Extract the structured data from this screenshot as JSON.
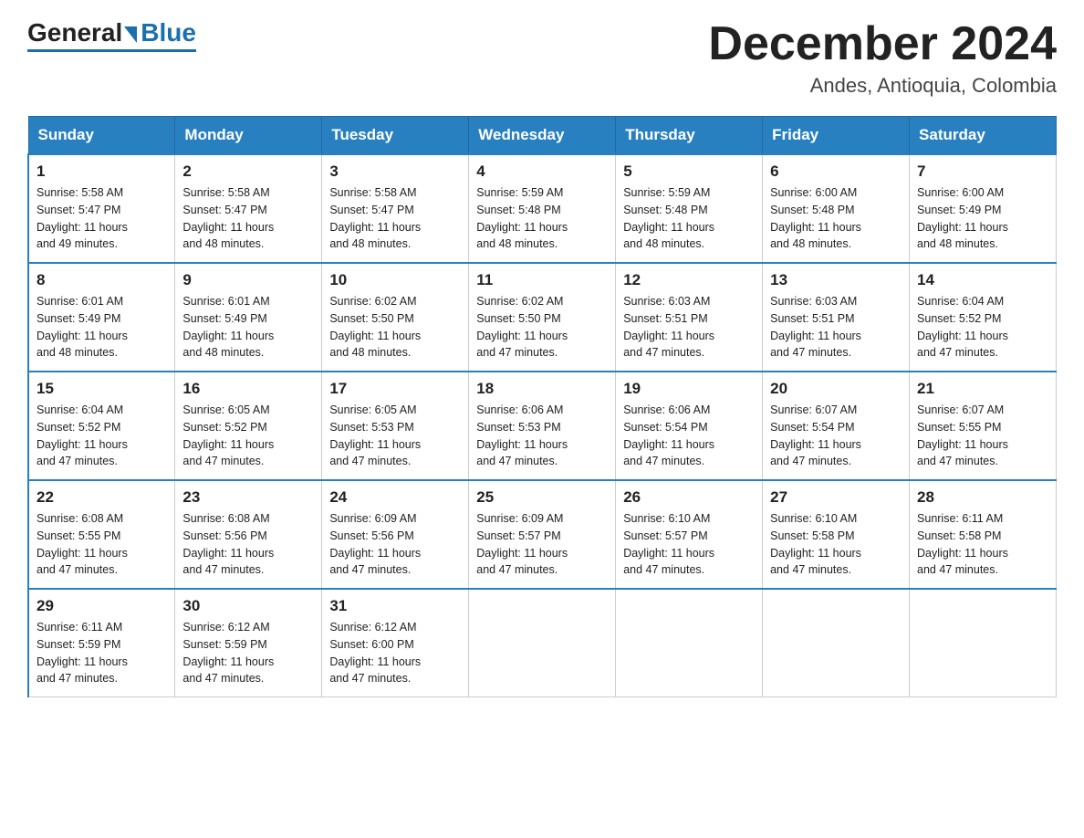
{
  "header": {
    "logo_general": "General",
    "logo_blue": "Blue",
    "month_title": "December 2024",
    "location": "Andes, Antioquia, Colombia"
  },
  "days_of_week": [
    "Sunday",
    "Monday",
    "Tuesday",
    "Wednesday",
    "Thursday",
    "Friday",
    "Saturday"
  ],
  "weeks": [
    [
      {
        "day": "1",
        "sunrise": "5:58 AM",
        "sunset": "5:47 PM",
        "daylight": "11 hours and 49 minutes."
      },
      {
        "day": "2",
        "sunrise": "5:58 AM",
        "sunset": "5:47 PM",
        "daylight": "11 hours and 48 minutes."
      },
      {
        "day": "3",
        "sunrise": "5:58 AM",
        "sunset": "5:47 PM",
        "daylight": "11 hours and 48 minutes."
      },
      {
        "day": "4",
        "sunrise": "5:59 AM",
        "sunset": "5:48 PM",
        "daylight": "11 hours and 48 minutes."
      },
      {
        "day": "5",
        "sunrise": "5:59 AM",
        "sunset": "5:48 PM",
        "daylight": "11 hours and 48 minutes."
      },
      {
        "day": "6",
        "sunrise": "6:00 AM",
        "sunset": "5:48 PM",
        "daylight": "11 hours and 48 minutes."
      },
      {
        "day": "7",
        "sunrise": "6:00 AM",
        "sunset": "5:49 PM",
        "daylight": "11 hours and 48 minutes."
      }
    ],
    [
      {
        "day": "8",
        "sunrise": "6:01 AM",
        "sunset": "5:49 PM",
        "daylight": "11 hours and 48 minutes."
      },
      {
        "day": "9",
        "sunrise": "6:01 AM",
        "sunset": "5:49 PM",
        "daylight": "11 hours and 48 minutes."
      },
      {
        "day": "10",
        "sunrise": "6:02 AM",
        "sunset": "5:50 PM",
        "daylight": "11 hours and 48 minutes."
      },
      {
        "day": "11",
        "sunrise": "6:02 AM",
        "sunset": "5:50 PM",
        "daylight": "11 hours and 47 minutes."
      },
      {
        "day": "12",
        "sunrise": "6:03 AM",
        "sunset": "5:51 PM",
        "daylight": "11 hours and 47 minutes."
      },
      {
        "day": "13",
        "sunrise": "6:03 AM",
        "sunset": "5:51 PM",
        "daylight": "11 hours and 47 minutes."
      },
      {
        "day": "14",
        "sunrise": "6:04 AM",
        "sunset": "5:52 PM",
        "daylight": "11 hours and 47 minutes."
      }
    ],
    [
      {
        "day": "15",
        "sunrise": "6:04 AM",
        "sunset": "5:52 PM",
        "daylight": "11 hours and 47 minutes."
      },
      {
        "day": "16",
        "sunrise": "6:05 AM",
        "sunset": "5:52 PM",
        "daylight": "11 hours and 47 minutes."
      },
      {
        "day": "17",
        "sunrise": "6:05 AM",
        "sunset": "5:53 PM",
        "daylight": "11 hours and 47 minutes."
      },
      {
        "day": "18",
        "sunrise": "6:06 AM",
        "sunset": "5:53 PM",
        "daylight": "11 hours and 47 minutes."
      },
      {
        "day": "19",
        "sunrise": "6:06 AM",
        "sunset": "5:54 PM",
        "daylight": "11 hours and 47 minutes."
      },
      {
        "day": "20",
        "sunrise": "6:07 AM",
        "sunset": "5:54 PM",
        "daylight": "11 hours and 47 minutes."
      },
      {
        "day": "21",
        "sunrise": "6:07 AM",
        "sunset": "5:55 PM",
        "daylight": "11 hours and 47 minutes."
      }
    ],
    [
      {
        "day": "22",
        "sunrise": "6:08 AM",
        "sunset": "5:55 PM",
        "daylight": "11 hours and 47 minutes."
      },
      {
        "day": "23",
        "sunrise": "6:08 AM",
        "sunset": "5:56 PM",
        "daylight": "11 hours and 47 minutes."
      },
      {
        "day": "24",
        "sunrise": "6:09 AM",
        "sunset": "5:56 PM",
        "daylight": "11 hours and 47 minutes."
      },
      {
        "day": "25",
        "sunrise": "6:09 AM",
        "sunset": "5:57 PM",
        "daylight": "11 hours and 47 minutes."
      },
      {
        "day": "26",
        "sunrise": "6:10 AM",
        "sunset": "5:57 PM",
        "daylight": "11 hours and 47 minutes."
      },
      {
        "day": "27",
        "sunrise": "6:10 AM",
        "sunset": "5:58 PM",
        "daylight": "11 hours and 47 minutes."
      },
      {
        "day": "28",
        "sunrise": "6:11 AM",
        "sunset": "5:58 PM",
        "daylight": "11 hours and 47 minutes."
      }
    ],
    [
      {
        "day": "29",
        "sunrise": "6:11 AM",
        "sunset": "5:59 PM",
        "daylight": "11 hours and 47 minutes."
      },
      {
        "day": "30",
        "sunrise": "6:12 AM",
        "sunset": "5:59 PM",
        "daylight": "11 hours and 47 minutes."
      },
      {
        "day": "31",
        "sunrise": "6:12 AM",
        "sunset": "6:00 PM",
        "daylight": "11 hours and 47 minutes."
      },
      null,
      null,
      null,
      null
    ]
  ],
  "labels": {
    "sunrise": "Sunrise:",
    "sunset": "Sunset:",
    "daylight": "Daylight:"
  }
}
